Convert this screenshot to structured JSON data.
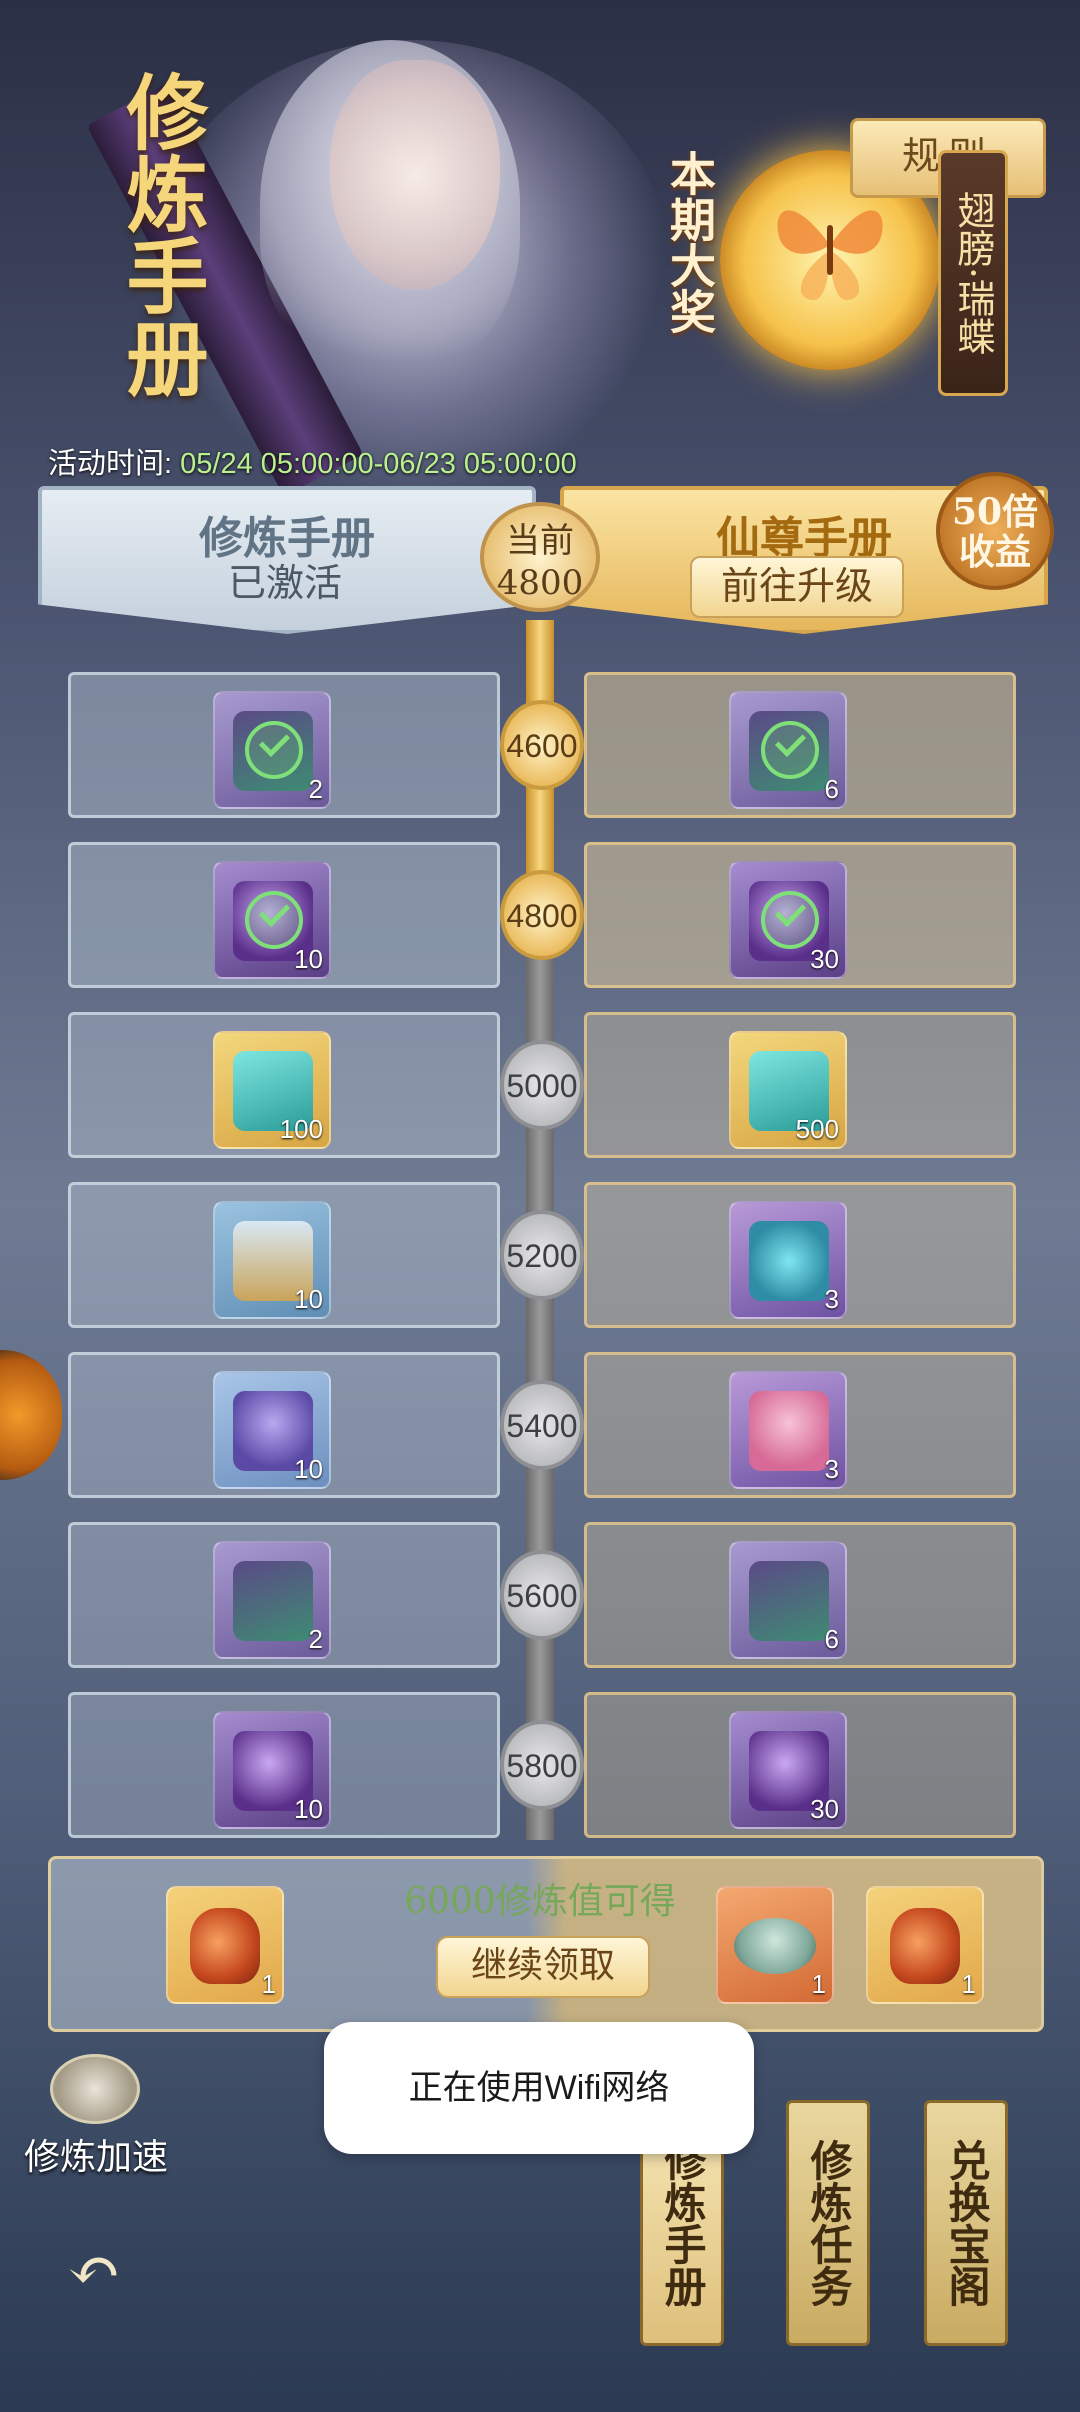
{
  "header": {
    "title": "修炼手册",
    "grand_prize_label": "本期大奖",
    "grand_prize_name": "翅膀·瑞蝶",
    "rules_label": "规则",
    "time_label": "活动时间:",
    "time_value": "05/24 05:00:00-06/23 05:00:00"
  },
  "tiers": {
    "free": {
      "title": "修炼手册",
      "status": "已激活"
    },
    "premium": {
      "title": "仙尊手册",
      "action": "前往升级",
      "badge": "50倍收益"
    },
    "current_label": "当前",
    "current_value": "4800"
  },
  "rows": [
    {
      "level": "4600",
      "claimed": true,
      "left": {
        "icon": "treasure-chest-icon",
        "count": "2"
      },
      "right": {
        "icon": "treasure-chest-icon",
        "count": "6"
      }
    },
    {
      "level": "4800",
      "claimed": true,
      "left": {
        "icon": "crystal-orb-icon",
        "count": "10"
      },
      "right": {
        "icon": "crystal-orb-icon",
        "count": "30"
      }
    },
    {
      "level": "5000",
      "claimed": false,
      "left": {
        "icon": "jade-shard-icon",
        "count": "100"
      },
      "right": {
        "icon": "jade-shard-icon",
        "count": "500"
      }
    },
    {
      "level": "5200",
      "claimed": false,
      "left": {
        "icon": "sand-pour-icon",
        "count": "10"
      },
      "right": {
        "icon": "spirit-cauldron-icon",
        "count": "3"
      }
    },
    {
      "level": "5400",
      "claimed": false,
      "left": {
        "icon": "iris-flower-icon",
        "count": "10"
      },
      "right": {
        "icon": "lotus-flower-icon",
        "count": "3"
      }
    },
    {
      "level": "5600",
      "claimed": false,
      "left": {
        "icon": "treasure-chest-icon",
        "count": "2"
      },
      "right": {
        "icon": "treasure-chest-icon",
        "count": "6"
      }
    },
    {
      "level": "5800",
      "claimed": false,
      "left": {
        "icon": "crystal-orb-icon",
        "count": "10"
      },
      "right": {
        "icon": "crystal-orb-icon",
        "count": "30"
      }
    }
  ],
  "bonus": {
    "text": "6000修炼值可得",
    "button": "继续领取",
    "items": [
      {
        "icon": "red-vase-icon",
        "count": "1"
      },
      {
        "icon": "jade-lamp-icon",
        "count": "1"
      },
      {
        "icon": "red-vase-icon",
        "count": "1"
      }
    ]
  },
  "nav": {
    "speed_up": "修炼加速",
    "back_icon": "back-arrow-icon",
    "tabs": [
      "修炼手册",
      "修炼任务",
      "兑换宝阁"
    ]
  },
  "toast": "正在使用Wifi网络",
  "colors": {
    "accent_gold": "#e6bc6b",
    "claimed_green": "#7fe07a",
    "time_green": "#b9f28c"
  }
}
